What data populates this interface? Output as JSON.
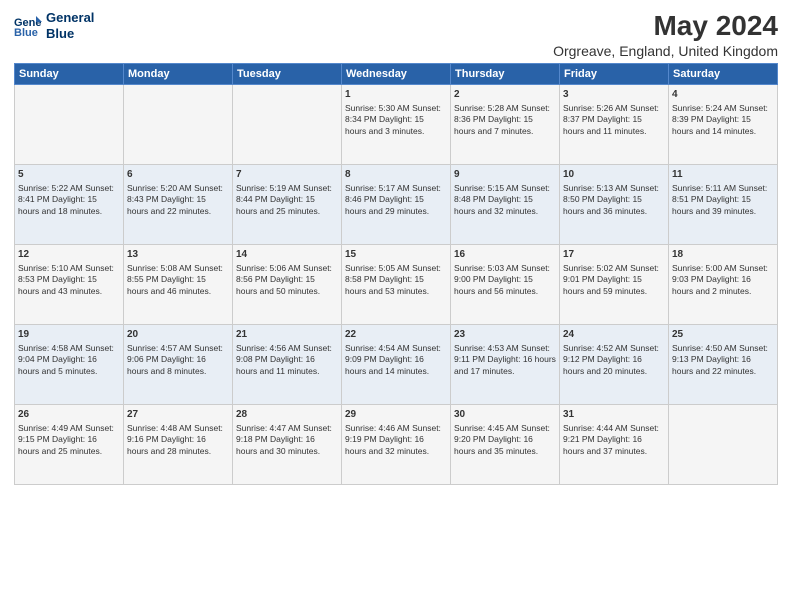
{
  "header": {
    "logo_line1": "General",
    "logo_line2": "Blue",
    "title": "May 2024",
    "subtitle": "Orgreave, England, United Kingdom"
  },
  "columns": [
    "Sunday",
    "Monday",
    "Tuesday",
    "Wednesday",
    "Thursday",
    "Friday",
    "Saturday"
  ],
  "weeks": [
    [
      {
        "day": "",
        "info": ""
      },
      {
        "day": "",
        "info": ""
      },
      {
        "day": "",
        "info": ""
      },
      {
        "day": "1",
        "info": "Sunrise: 5:30 AM\nSunset: 8:34 PM\nDaylight: 15 hours\nand 3 minutes."
      },
      {
        "day": "2",
        "info": "Sunrise: 5:28 AM\nSunset: 8:36 PM\nDaylight: 15 hours\nand 7 minutes."
      },
      {
        "day": "3",
        "info": "Sunrise: 5:26 AM\nSunset: 8:37 PM\nDaylight: 15 hours\nand 11 minutes."
      },
      {
        "day": "4",
        "info": "Sunrise: 5:24 AM\nSunset: 8:39 PM\nDaylight: 15 hours\nand 14 minutes."
      }
    ],
    [
      {
        "day": "5",
        "info": "Sunrise: 5:22 AM\nSunset: 8:41 PM\nDaylight: 15 hours\nand 18 minutes."
      },
      {
        "day": "6",
        "info": "Sunrise: 5:20 AM\nSunset: 8:43 PM\nDaylight: 15 hours\nand 22 minutes."
      },
      {
        "day": "7",
        "info": "Sunrise: 5:19 AM\nSunset: 8:44 PM\nDaylight: 15 hours\nand 25 minutes."
      },
      {
        "day": "8",
        "info": "Sunrise: 5:17 AM\nSunset: 8:46 PM\nDaylight: 15 hours\nand 29 minutes."
      },
      {
        "day": "9",
        "info": "Sunrise: 5:15 AM\nSunset: 8:48 PM\nDaylight: 15 hours\nand 32 minutes."
      },
      {
        "day": "10",
        "info": "Sunrise: 5:13 AM\nSunset: 8:50 PM\nDaylight: 15 hours\nand 36 minutes."
      },
      {
        "day": "11",
        "info": "Sunrise: 5:11 AM\nSunset: 8:51 PM\nDaylight: 15 hours\nand 39 minutes."
      }
    ],
    [
      {
        "day": "12",
        "info": "Sunrise: 5:10 AM\nSunset: 8:53 PM\nDaylight: 15 hours\nand 43 minutes."
      },
      {
        "day": "13",
        "info": "Sunrise: 5:08 AM\nSunset: 8:55 PM\nDaylight: 15 hours\nand 46 minutes."
      },
      {
        "day": "14",
        "info": "Sunrise: 5:06 AM\nSunset: 8:56 PM\nDaylight: 15 hours\nand 50 minutes."
      },
      {
        "day": "15",
        "info": "Sunrise: 5:05 AM\nSunset: 8:58 PM\nDaylight: 15 hours\nand 53 minutes."
      },
      {
        "day": "16",
        "info": "Sunrise: 5:03 AM\nSunset: 9:00 PM\nDaylight: 15 hours\nand 56 minutes."
      },
      {
        "day": "17",
        "info": "Sunrise: 5:02 AM\nSunset: 9:01 PM\nDaylight: 15 hours\nand 59 minutes."
      },
      {
        "day": "18",
        "info": "Sunrise: 5:00 AM\nSunset: 9:03 PM\nDaylight: 16 hours\nand 2 minutes."
      }
    ],
    [
      {
        "day": "19",
        "info": "Sunrise: 4:58 AM\nSunset: 9:04 PM\nDaylight: 16 hours\nand 5 minutes."
      },
      {
        "day": "20",
        "info": "Sunrise: 4:57 AM\nSunset: 9:06 PM\nDaylight: 16 hours\nand 8 minutes."
      },
      {
        "day": "21",
        "info": "Sunrise: 4:56 AM\nSunset: 9:08 PM\nDaylight: 16 hours\nand 11 minutes."
      },
      {
        "day": "22",
        "info": "Sunrise: 4:54 AM\nSunset: 9:09 PM\nDaylight: 16 hours\nand 14 minutes."
      },
      {
        "day": "23",
        "info": "Sunrise: 4:53 AM\nSunset: 9:11 PM\nDaylight: 16 hours\nand 17 minutes."
      },
      {
        "day": "24",
        "info": "Sunrise: 4:52 AM\nSunset: 9:12 PM\nDaylight: 16 hours\nand 20 minutes."
      },
      {
        "day": "25",
        "info": "Sunrise: 4:50 AM\nSunset: 9:13 PM\nDaylight: 16 hours\nand 22 minutes."
      }
    ],
    [
      {
        "day": "26",
        "info": "Sunrise: 4:49 AM\nSunset: 9:15 PM\nDaylight: 16 hours\nand 25 minutes."
      },
      {
        "day": "27",
        "info": "Sunrise: 4:48 AM\nSunset: 9:16 PM\nDaylight: 16 hours\nand 28 minutes."
      },
      {
        "day": "28",
        "info": "Sunrise: 4:47 AM\nSunset: 9:18 PM\nDaylight: 16 hours\nand 30 minutes."
      },
      {
        "day": "29",
        "info": "Sunrise: 4:46 AM\nSunset: 9:19 PM\nDaylight: 16 hours\nand 32 minutes."
      },
      {
        "day": "30",
        "info": "Sunrise: 4:45 AM\nSunset: 9:20 PM\nDaylight: 16 hours\nand 35 minutes."
      },
      {
        "day": "31",
        "info": "Sunrise: 4:44 AM\nSunset: 9:21 PM\nDaylight: 16 hours\nand 37 minutes."
      },
      {
        "day": "",
        "info": ""
      }
    ]
  ]
}
